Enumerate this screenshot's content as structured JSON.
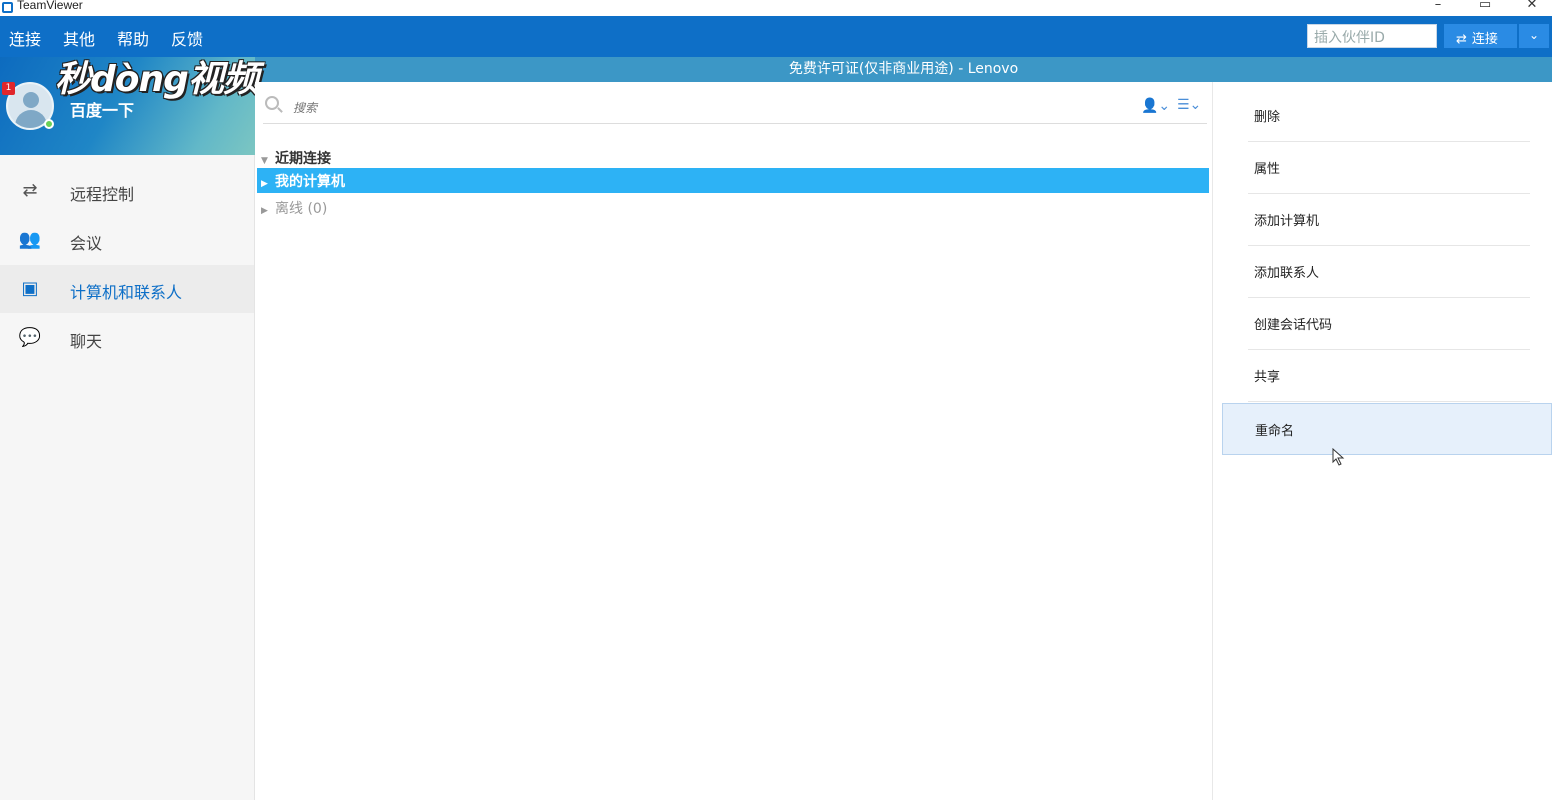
{
  "window": {
    "title": "TeamViewer",
    "controls": {
      "minimize": "–",
      "restore": "▭",
      "close": "✕"
    }
  },
  "menubar": {
    "items": [
      "连接",
      "其他",
      "帮助",
      "反馈"
    ],
    "partner_id_placeholder": "插入伙伴ID",
    "connect_label": "连接",
    "connect_dropdown": "⌄"
  },
  "license_banner": "免费许可证(仅非商业用途) - Lenovo",
  "profile": {
    "username": "百度一下",
    "notification_count": "1",
    "watermark": "秒dòng视频"
  },
  "nav": {
    "items": [
      {
        "label": "远程控制",
        "icon": "remote-control-icon"
      },
      {
        "label": "会议",
        "icon": "meeting-icon"
      },
      {
        "label": "计算机和联系人",
        "icon": "contacts-icon",
        "active": true
      },
      {
        "label": "聊天",
        "icon": "chat-icon"
      }
    ]
  },
  "center": {
    "search_placeholder": "搜索",
    "groups": [
      {
        "label": "近期连接",
        "expanded": true
      },
      {
        "label": "我的计算机",
        "selected": true
      },
      {
        "label": "离线 (0)"
      }
    ]
  },
  "context_menu": {
    "items": [
      "删除",
      "属性",
      "添加计算机",
      "添加联系人",
      "创建会话代码",
      "共享",
      "重命名"
    ],
    "hover_index": 6
  },
  "colors": {
    "menubar": "#0e6fc7",
    "license_strip": "#3c97c6",
    "selection": "#2db2f5",
    "accent": "#0e6fc7"
  }
}
